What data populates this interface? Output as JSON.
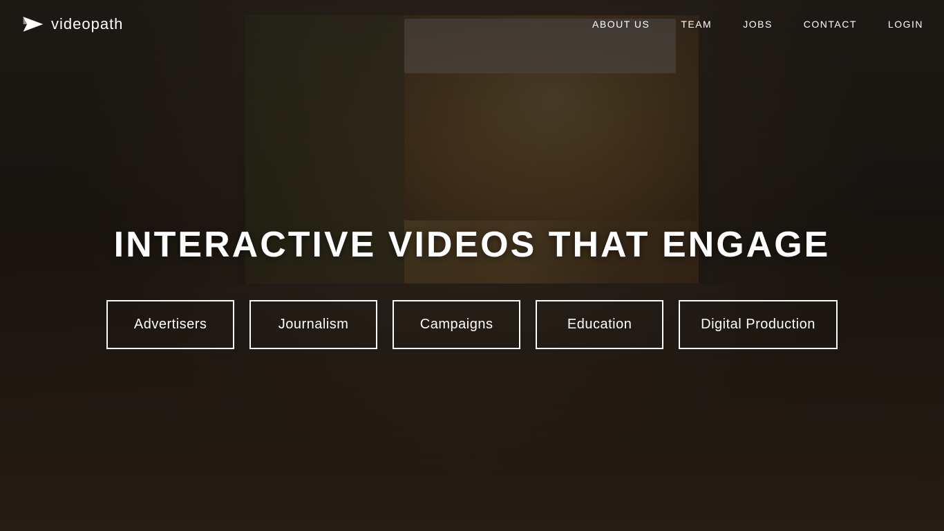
{
  "logo": {
    "text": "videopath",
    "icon_name": "paper-plane-icon"
  },
  "nav": {
    "links": [
      {
        "id": "about-us",
        "label": "ABOUT US"
      },
      {
        "id": "team",
        "label": "TEAM"
      },
      {
        "id": "jobs",
        "label": "JOBS"
      },
      {
        "id": "contact",
        "label": "CONTACT"
      },
      {
        "id": "login",
        "label": "LOGIN"
      }
    ]
  },
  "hero": {
    "title": "INTERACTIVE VIDEOS THAT ENGAGE"
  },
  "categories": [
    {
      "id": "advertisers",
      "label": "Advertisers"
    },
    {
      "id": "journalism",
      "label": "Journalism"
    },
    {
      "id": "campaigns",
      "label": "Campaigns"
    },
    {
      "id": "education",
      "label": "Education"
    },
    {
      "id": "digital-production",
      "label": "Digital Production"
    }
  ]
}
